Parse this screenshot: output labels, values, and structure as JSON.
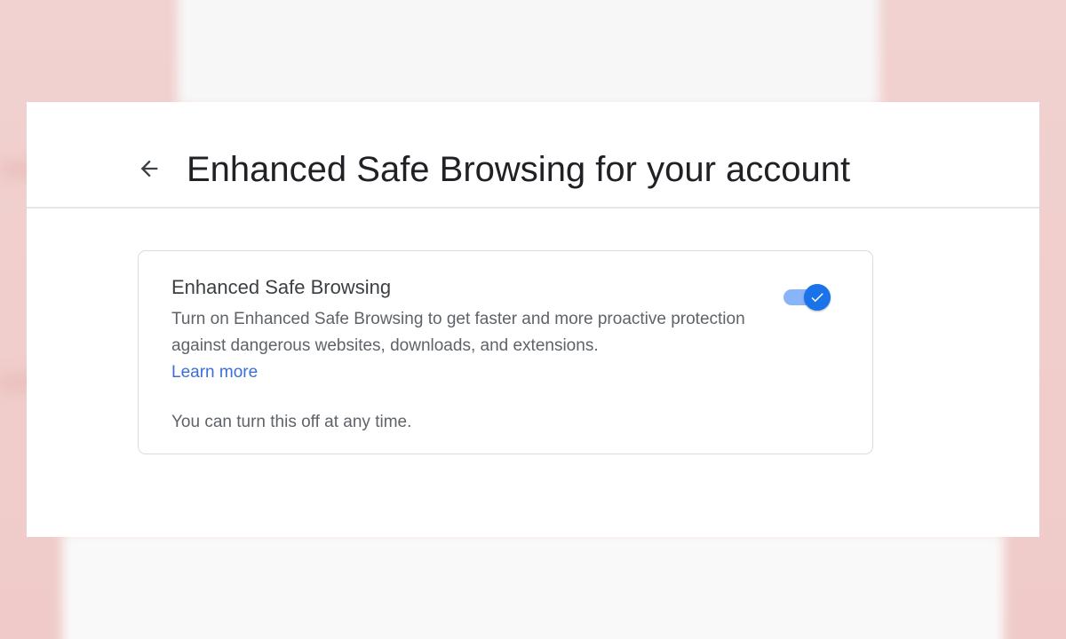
{
  "page": {
    "title": "Enhanced Safe Browsing for your account"
  },
  "setting": {
    "title": "Enhanced Safe Browsing",
    "description": "Turn on Enhanced Safe Browsing to get faster and more proactive protection against dangerous websites, downloads, and extensions.",
    "learn_more": "Learn more",
    "note": "You can turn this off at any time.",
    "enabled": true
  },
  "icons": {
    "back": "arrow-left-icon",
    "toggle_check": "check-icon"
  },
  "colors": {
    "accent": "#1a73e8",
    "track": "#8ab4f8",
    "link": "#3b6fd8",
    "backdrop": "#f0cdcb"
  }
}
